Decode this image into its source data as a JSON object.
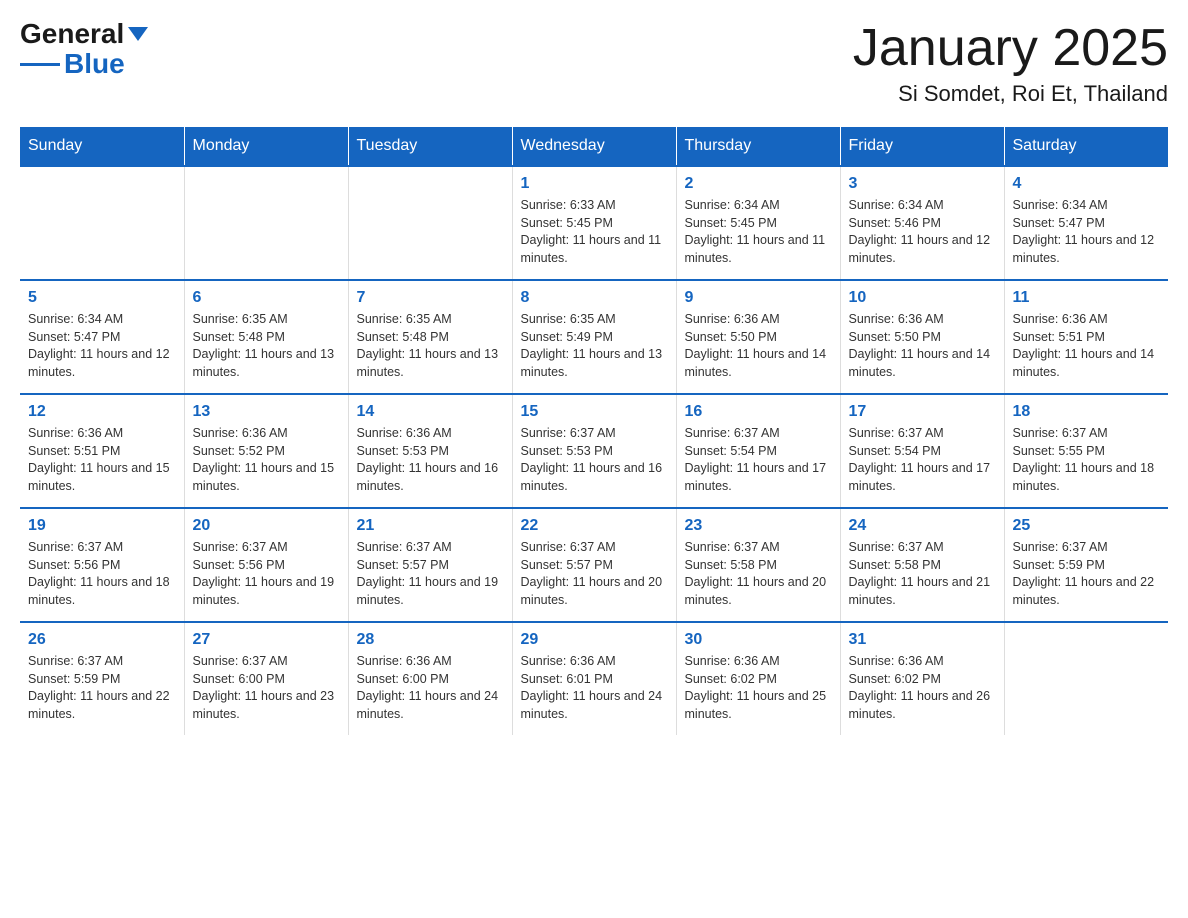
{
  "logo": {
    "general": "General",
    "blue": "Blue"
  },
  "title": "January 2025",
  "subtitle": "Si Somdet, Roi Et, Thailand",
  "days_of_week": [
    "Sunday",
    "Monday",
    "Tuesday",
    "Wednesday",
    "Thursday",
    "Friday",
    "Saturday"
  ],
  "weeks": [
    [
      {
        "day": "",
        "info": ""
      },
      {
        "day": "",
        "info": ""
      },
      {
        "day": "",
        "info": ""
      },
      {
        "day": "1",
        "info": "Sunrise: 6:33 AM\nSunset: 5:45 PM\nDaylight: 11 hours and 11 minutes."
      },
      {
        "day": "2",
        "info": "Sunrise: 6:34 AM\nSunset: 5:45 PM\nDaylight: 11 hours and 11 minutes."
      },
      {
        "day": "3",
        "info": "Sunrise: 6:34 AM\nSunset: 5:46 PM\nDaylight: 11 hours and 12 minutes."
      },
      {
        "day": "4",
        "info": "Sunrise: 6:34 AM\nSunset: 5:47 PM\nDaylight: 11 hours and 12 minutes."
      }
    ],
    [
      {
        "day": "5",
        "info": "Sunrise: 6:34 AM\nSunset: 5:47 PM\nDaylight: 11 hours and 12 minutes."
      },
      {
        "day": "6",
        "info": "Sunrise: 6:35 AM\nSunset: 5:48 PM\nDaylight: 11 hours and 13 minutes."
      },
      {
        "day": "7",
        "info": "Sunrise: 6:35 AM\nSunset: 5:48 PM\nDaylight: 11 hours and 13 minutes."
      },
      {
        "day": "8",
        "info": "Sunrise: 6:35 AM\nSunset: 5:49 PM\nDaylight: 11 hours and 13 minutes."
      },
      {
        "day": "9",
        "info": "Sunrise: 6:36 AM\nSunset: 5:50 PM\nDaylight: 11 hours and 14 minutes."
      },
      {
        "day": "10",
        "info": "Sunrise: 6:36 AM\nSunset: 5:50 PM\nDaylight: 11 hours and 14 minutes."
      },
      {
        "day": "11",
        "info": "Sunrise: 6:36 AM\nSunset: 5:51 PM\nDaylight: 11 hours and 14 minutes."
      }
    ],
    [
      {
        "day": "12",
        "info": "Sunrise: 6:36 AM\nSunset: 5:51 PM\nDaylight: 11 hours and 15 minutes."
      },
      {
        "day": "13",
        "info": "Sunrise: 6:36 AM\nSunset: 5:52 PM\nDaylight: 11 hours and 15 minutes."
      },
      {
        "day": "14",
        "info": "Sunrise: 6:36 AM\nSunset: 5:53 PM\nDaylight: 11 hours and 16 minutes."
      },
      {
        "day": "15",
        "info": "Sunrise: 6:37 AM\nSunset: 5:53 PM\nDaylight: 11 hours and 16 minutes."
      },
      {
        "day": "16",
        "info": "Sunrise: 6:37 AM\nSunset: 5:54 PM\nDaylight: 11 hours and 17 minutes."
      },
      {
        "day": "17",
        "info": "Sunrise: 6:37 AM\nSunset: 5:54 PM\nDaylight: 11 hours and 17 minutes."
      },
      {
        "day": "18",
        "info": "Sunrise: 6:37 AM\nSunset: 5:55 PM\nDaylight: 11 hours and 18 minutes."
      }
    ],
    [
      {
        "day": "19",
        "info": "Sunrise: 6:37 AM\nSunset: 5:56 PM\nDaylight: 11 hours and 18 minutes."
      },
      {
        "day": "20",
        "info": "Sunrise: 6:37 AM\nSunset: 5:56 PM\nDaylight: 11 hours and 19 minutes."
      },
      {
        "day": "21",
        "info": "Sunrise: 6:37 AM\nSunset: 5:57 PM\nDaylight: 11 hours and 19 minutes."
      },
      {
        "day": "22",
        "info": "Sunrise: 6:37 AM\nSunset: 5:57 PM\nDaylight: 11 hours and 20 minutes."
      },
      {
        "day": "23",
        "info": "Sunrise: 6:37 AM\nSunset: 5:58 PM\nDaylight: 11 hours and 20 minutes."
      },
      {
        "day": "24",
        "info": "Sunrise: 6:37 AM\nSunset: 5:58 PM\nDaylight: 11 hours and 21 minutes."
      },
      {
        "day": "25",
        "info": "Sunrise: 6:37 AM\nSunset: 5:59 PM\nDaylight: 11 hours and 22 minutes."
      }
    ],
    [
      {
        "day": "26",
        "info": "Sunrise: 6:37 AM\nSunset: 5:59 PM\nDaylight: 11 hours and 22 minutes."
      },
      {
        "day": "27",
        "info": "Sunrise: 6:37 AM\nSunset: 6:00 PM\nDaylight: 11 hours and 23 minutes."
      },
      {
        "day": "28",
        "info": "Sunrise: 6:36 AM\nSunset: 6:00 PM\nDaylight: 11 hours and 24 minutes."
      },
      {
        "day": "29",
        "info": "Sunrise: 6:36 AM\nSunset: 6:01 PM\nDaylight: 11 hours and 24 minutes."
      },
      {
        "day": "30",
        "info": "Sunrise: 6:36 AM\nSunset: 6:02 PM\nDaylight: 11 hours and 25 minutes."
      },
      {
        "day": "31",
        "info": "Sunrise: 6:36 AM\nSunset: 6:02 PM\nDaylight: 11 hours and 26 minutes."
      },
      {
        "day": "",
        "info": ""
      }
    ]
  ]
}
